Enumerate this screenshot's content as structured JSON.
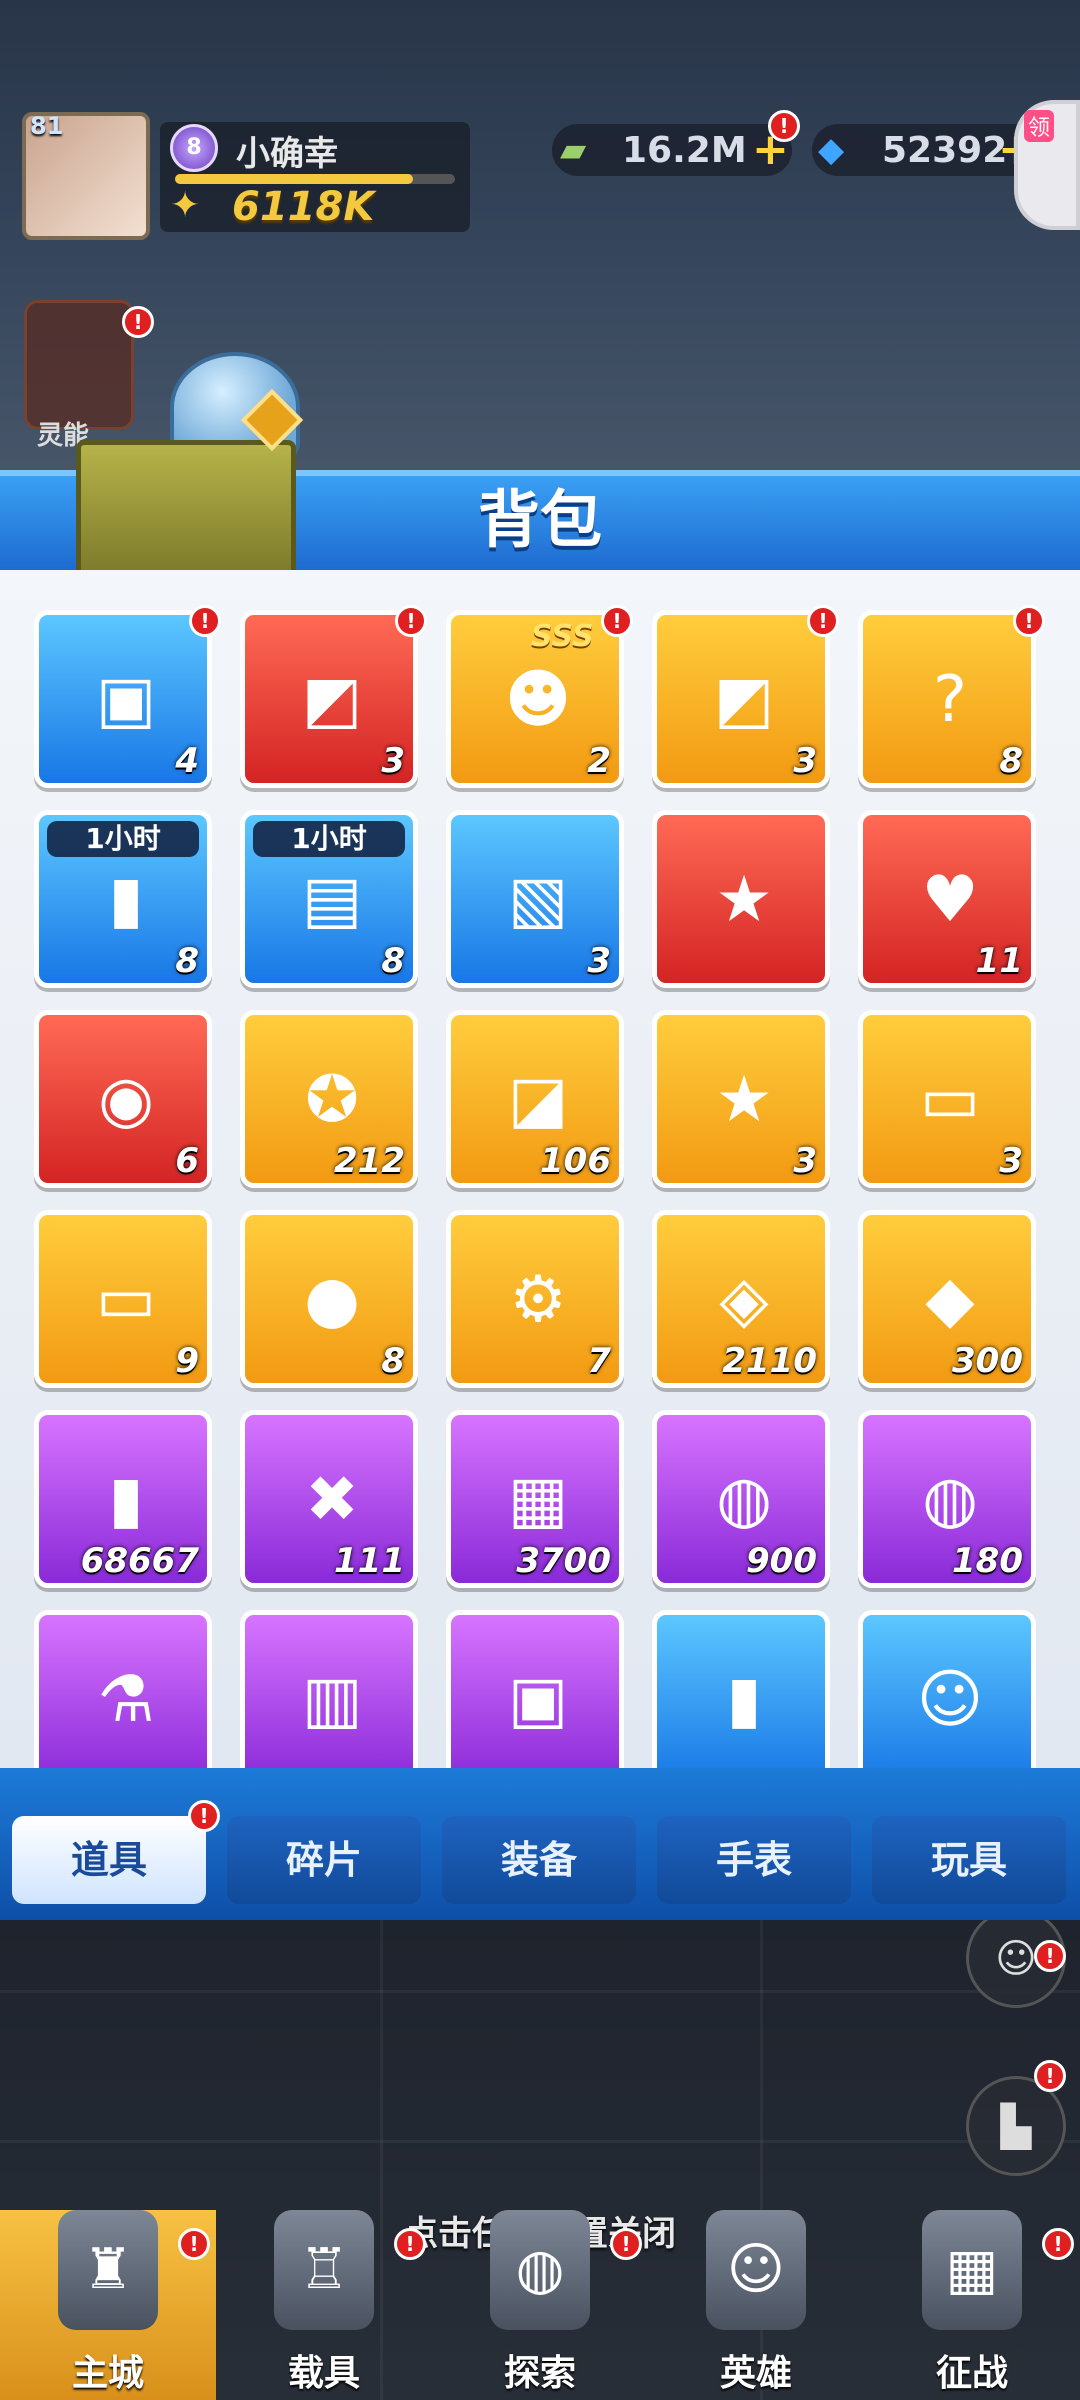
{
  "hud": {
    "level": "81",
    "rank": "8",
    "player_name": "小确幸",
    "exp_progress": 0.85,
    "power": "6118K",
    "cash": "16.2M",
    "gems": "52392",
    "corner_label": "领",
    "side_label": "灵能"
  },
  "panel": {
    "title": "背包"
  },
  "items": [
    {
      "count": "4",
      "icon": "chest-icon",
      "color": "blue",
      "alert": true
    },
    {
      "count": "3",
      "icon": "purple-book-icon",
      "color": "red",
      "alert": true
    },
    {
      "count": "2",
      "icon": "sss-hero-card-icon",
      "tag_overlay": "SSS",
      "color": "orange",
      "alert": true
    },
    {
      "count": "3",
      "icon": "blue-book-icon",
      "color": "orange",
      "alert": true
    },
    {
      "count": "8",
      "icon": "mystery-book-icon",
      "color": "orange",
      "alert": true
    },
    {
      "count": "8",
      "icon": "exp-can-icon",
      "tag": "1小时",
      "color": "blue"
    },
    {
      "count": "8",
      "icon": "cash-stack-icon",
      "tag": "1小时",
      "color": "blue"
    },
    {
      "count": "3",
      "icon": "red-ticket-card-icon",
      "color": "blue"
    },
    {
      "count": "",
      "icon": "red-star-book-icon",
      "color": "red"
    },
    {
      "count": "11",
      "icon": "crystal-heart-icon",
      "color": "red"
    },
    {
      "count": "6",
      "icon": "gold-planet-icon",
      "color": "red"
    },
    {
      "count": "212",
      "icon": "star-medal-icon",
      "color": "orange"
    },
    {
      "count": "106",
      "icon": "purple-card-icon",
      "color": "orange"
    },
    {
      "count": "3",
      "icon": "red-star-book-icon",
      "color": "orange"
    },
    {
      "count": "3",
      "icon": "orange-ticket-icon",
      "color": "orange"
    },
    {
      "count": "9",
      "icon": "red-ticket-icon",
      "color": "orange"
    },
    {
      "count": "8",
      "icon": "purple-orb-icon",
      "color": "orange"
    },
    {
      "count": "7",
      "icon": "machine-part-icon",
      "color": "orange"
    },
    {
      "count": "2110",
      "icon": "blue-emblem-icon",
      "color": "orange"
    },
    {
      "count": "300",
      "icon": "crystal-ore-icon",
      "color": "orange"
    },
    {
      "count": "68667",
      "icon": "yellow-canister-icon",
      "color": "purple"
    },
    {
      "count": "111",
      "icon": "tool-card-icon",
      "color": "purple"
    },
    {
      "count": "3700",
      "icon": "circuit-board-icon",
      "color": "purple"
    },
    {
      "count": "900",
      "icon": "green-badge-icon",
      "color": "purple"
    },
    {
      "count": "180",
      "icon": "blue-badge-icon",
      "color": "purple"
    },
    {
      "count": "",
      "icon": "green-potion-icon",
      "color": "purple"
    },
    {
      "count": "",
      "icon": "green-chip-icon",
      "color": "purple"
    },
    {
      "count": "",
      "icon": "red-device-icon",
      "color": "purple"
    },
    {
      "count": "",
      "icon": "blue-exp-can-icon",
      "color": "blue"
    },
    {
      "count": "",
      "icon": "soldier-portrait-icon",
      "color": "blue"
    }
  ],
  "tabs": [
    {
      "label": "道具",
      "active": true,
      "alert": true
    },
    {
      "label": "碎片"
    },
    {
      "label": "装备"
    },
    {
      "label": "手表"
    },
    {
      "label": "玩具"
    }
  ],
  "close_hint": "点击任意位置关闭",
  "bottom_nav": [
    {
      "label": "主城",
      "active": true,
      "alert": true,
      "icon": "castle-icon"
    },
    {
      "label": "载具",
      "alert": true,
      "icon": "robot-icon"
    },
    {
      "label": "探索",
      "alert": true,
      "icon": "globe-icon"
    },
    {
      "label": "英雄",
      "icon": "hero-icon"
    },
    {
      "label": "征战",
      "alert": true,
      "icon": "battle-icon"
    }
  ],
  "colors": {
    "header_blue": "#1e6bd0",
    "item_blue": "#1877e6",
    "item_red": "#d42424",
    "item_orange": "#f29a12",
    "item_purple": "#8a2ad8",
    "alert_red": "#e02020",
    "power_gold": "#f3c93f"
  }
}
